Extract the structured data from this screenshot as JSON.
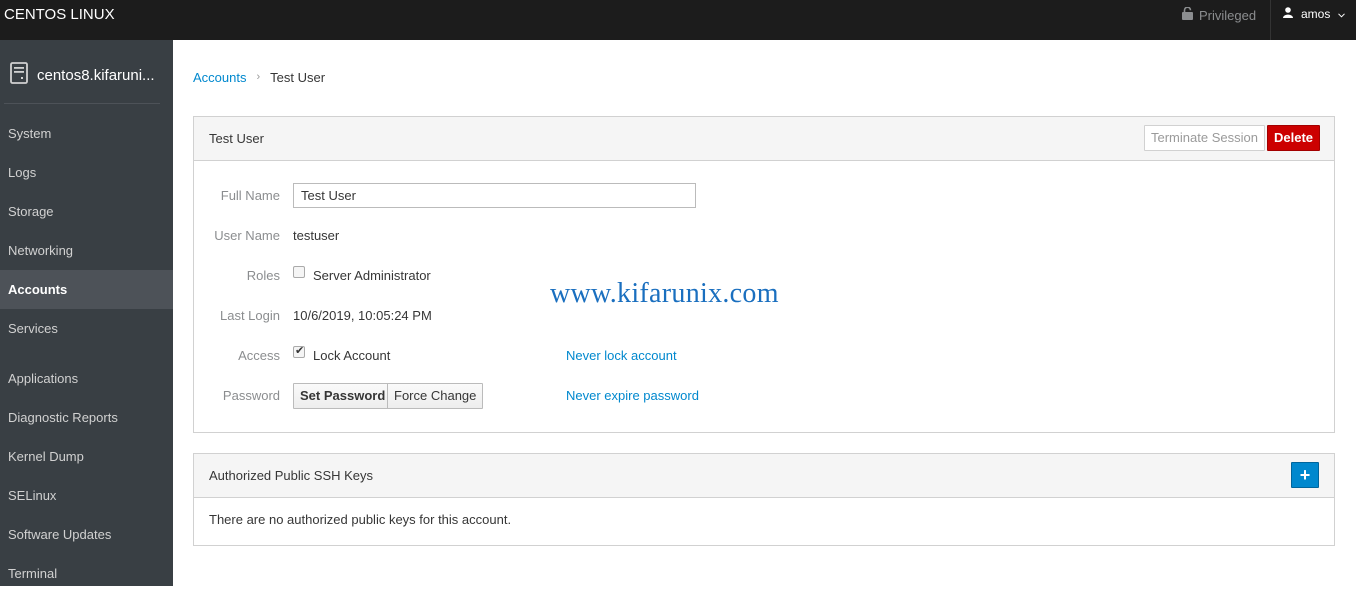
{
  "topbar": {
    "brand": "CENTOS LINUX",
    "privileged_label": "Privileged",
    "user_name": "amos"
  },
  "sidebar": {
    "host": "centos8.kifaruni...",
    "items": [
      {
        "label": "System",
        "active": false
      },
      {
        "label": "Logs",
        "active": false
      },
      {
        "label": "Storage",
        "active": false
      },
      {
        "label": "Networking",
        "active": false
      },
      {
        "label": "Accounts",
        "active": true
      },
      {
        "label": "Services",
        "active": false
      },
      {
        "label": "Applications",
        "active": false
      },
      {
        "label": "Diagnostic Reports",
        "active": false
      },
      {
        "label": "Kernel Dump",
        "active": false
      },
      {
        "label": "SELinux",
        "active": false
      },
      {
        "label": "Software Updates",
        "active": false
      },
      {
        "label": "Terminal",
        "active": false
      }
    ]
  },
  "breadcrumb": {
    "parent": "Accounts",
    "separator": "›",
    "current": "Test User"
  },
  "user_panel": {
    "title": "Test User",
    "terminate_label": "Terminate Session",
    "delete_label": "Delete",
    "full_name_label": "Full Name",
    "full_name_value": "Test User",
    "user_name_label": "User Name",
    "user_name_value": "testuser",
    "roles_label": "Roles",
    "role_server_admin": "Server Administrator",
    "role_server_admin_checked": false,
    "last_login_label": "Last Login",
    "last_login_value": "10/6/2019, 10:05:24 PM",
    "access_label": "Access",
    "lock_account_label": "Lock Account",
    "lock_account_checked": true,
    "never_lock_link": "Never lock account",
    "password_label": "Password",
    "set_password_label": "Set Password",
    "force_change_label": "Force Change",
    "never_expire_link": "Never expire password"
  },
  "ssh_panel": {
    "title": "Authorized Public SSH Keys",
    "add_label": "+",
    "empty_message": "There are no authorized public keys for this account."
  },
  "watermark": "www.kifarunix.com"
}
